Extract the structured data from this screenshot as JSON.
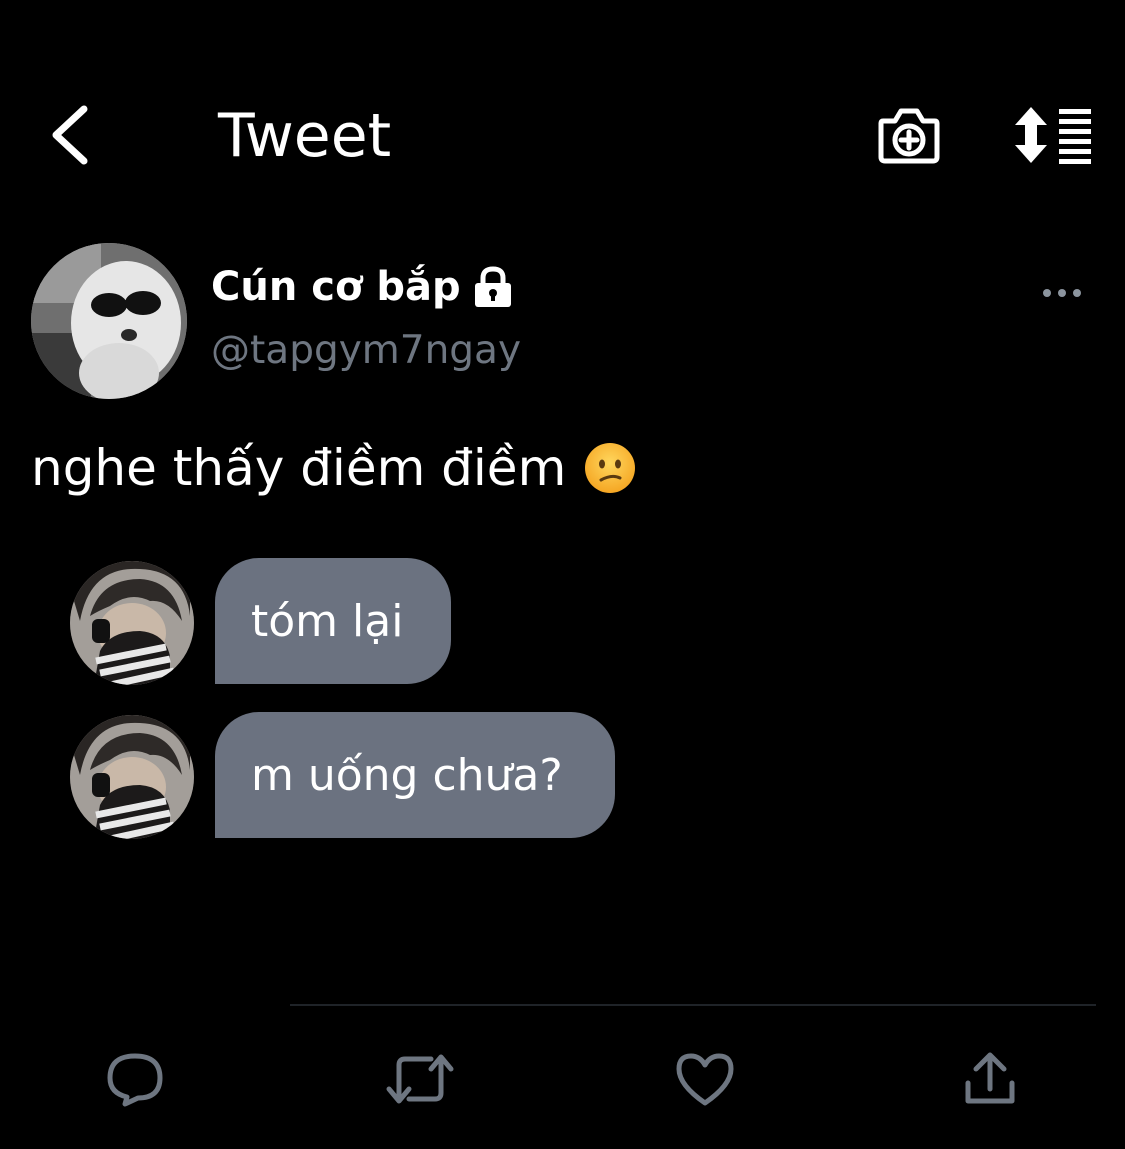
{
  "header": {
    "title": "Tweet",
    "back_icon": "chevron-left-icon",
    "camera_icon": "camera-plus-icon",
    "sort_icon": "sort-list-icon"
  },
  "author": {
    "display_name": "Cún cơ bắp",
    "handle": "@tapgym7ngay",
    "protected_icon": "lock-icon"
  },
  "tweet": {
    "text": "nghe thấy điềm điềm",
    "emoji": "😕"
  },
  "chat": {
    "messages": [
      {
        "text": "tóm lại"
      },
      {
        "text": "m uống chưa?"
      }
    ]
  },
  "actions": {
    "reply_icon": "reply-icon",
    "retweet_icon": "retweet-icon",
    "like_icon": "heart-icon",
    "share_icon": "share-icon"
  },
  "colors": {
    "background": "#000000",
    "text_primary": "#ffffff",
    "text_secondary": "#6e7681",
    "bubble": "#6b7280",
    "icon_muted": "#6e7681"
  }
}
